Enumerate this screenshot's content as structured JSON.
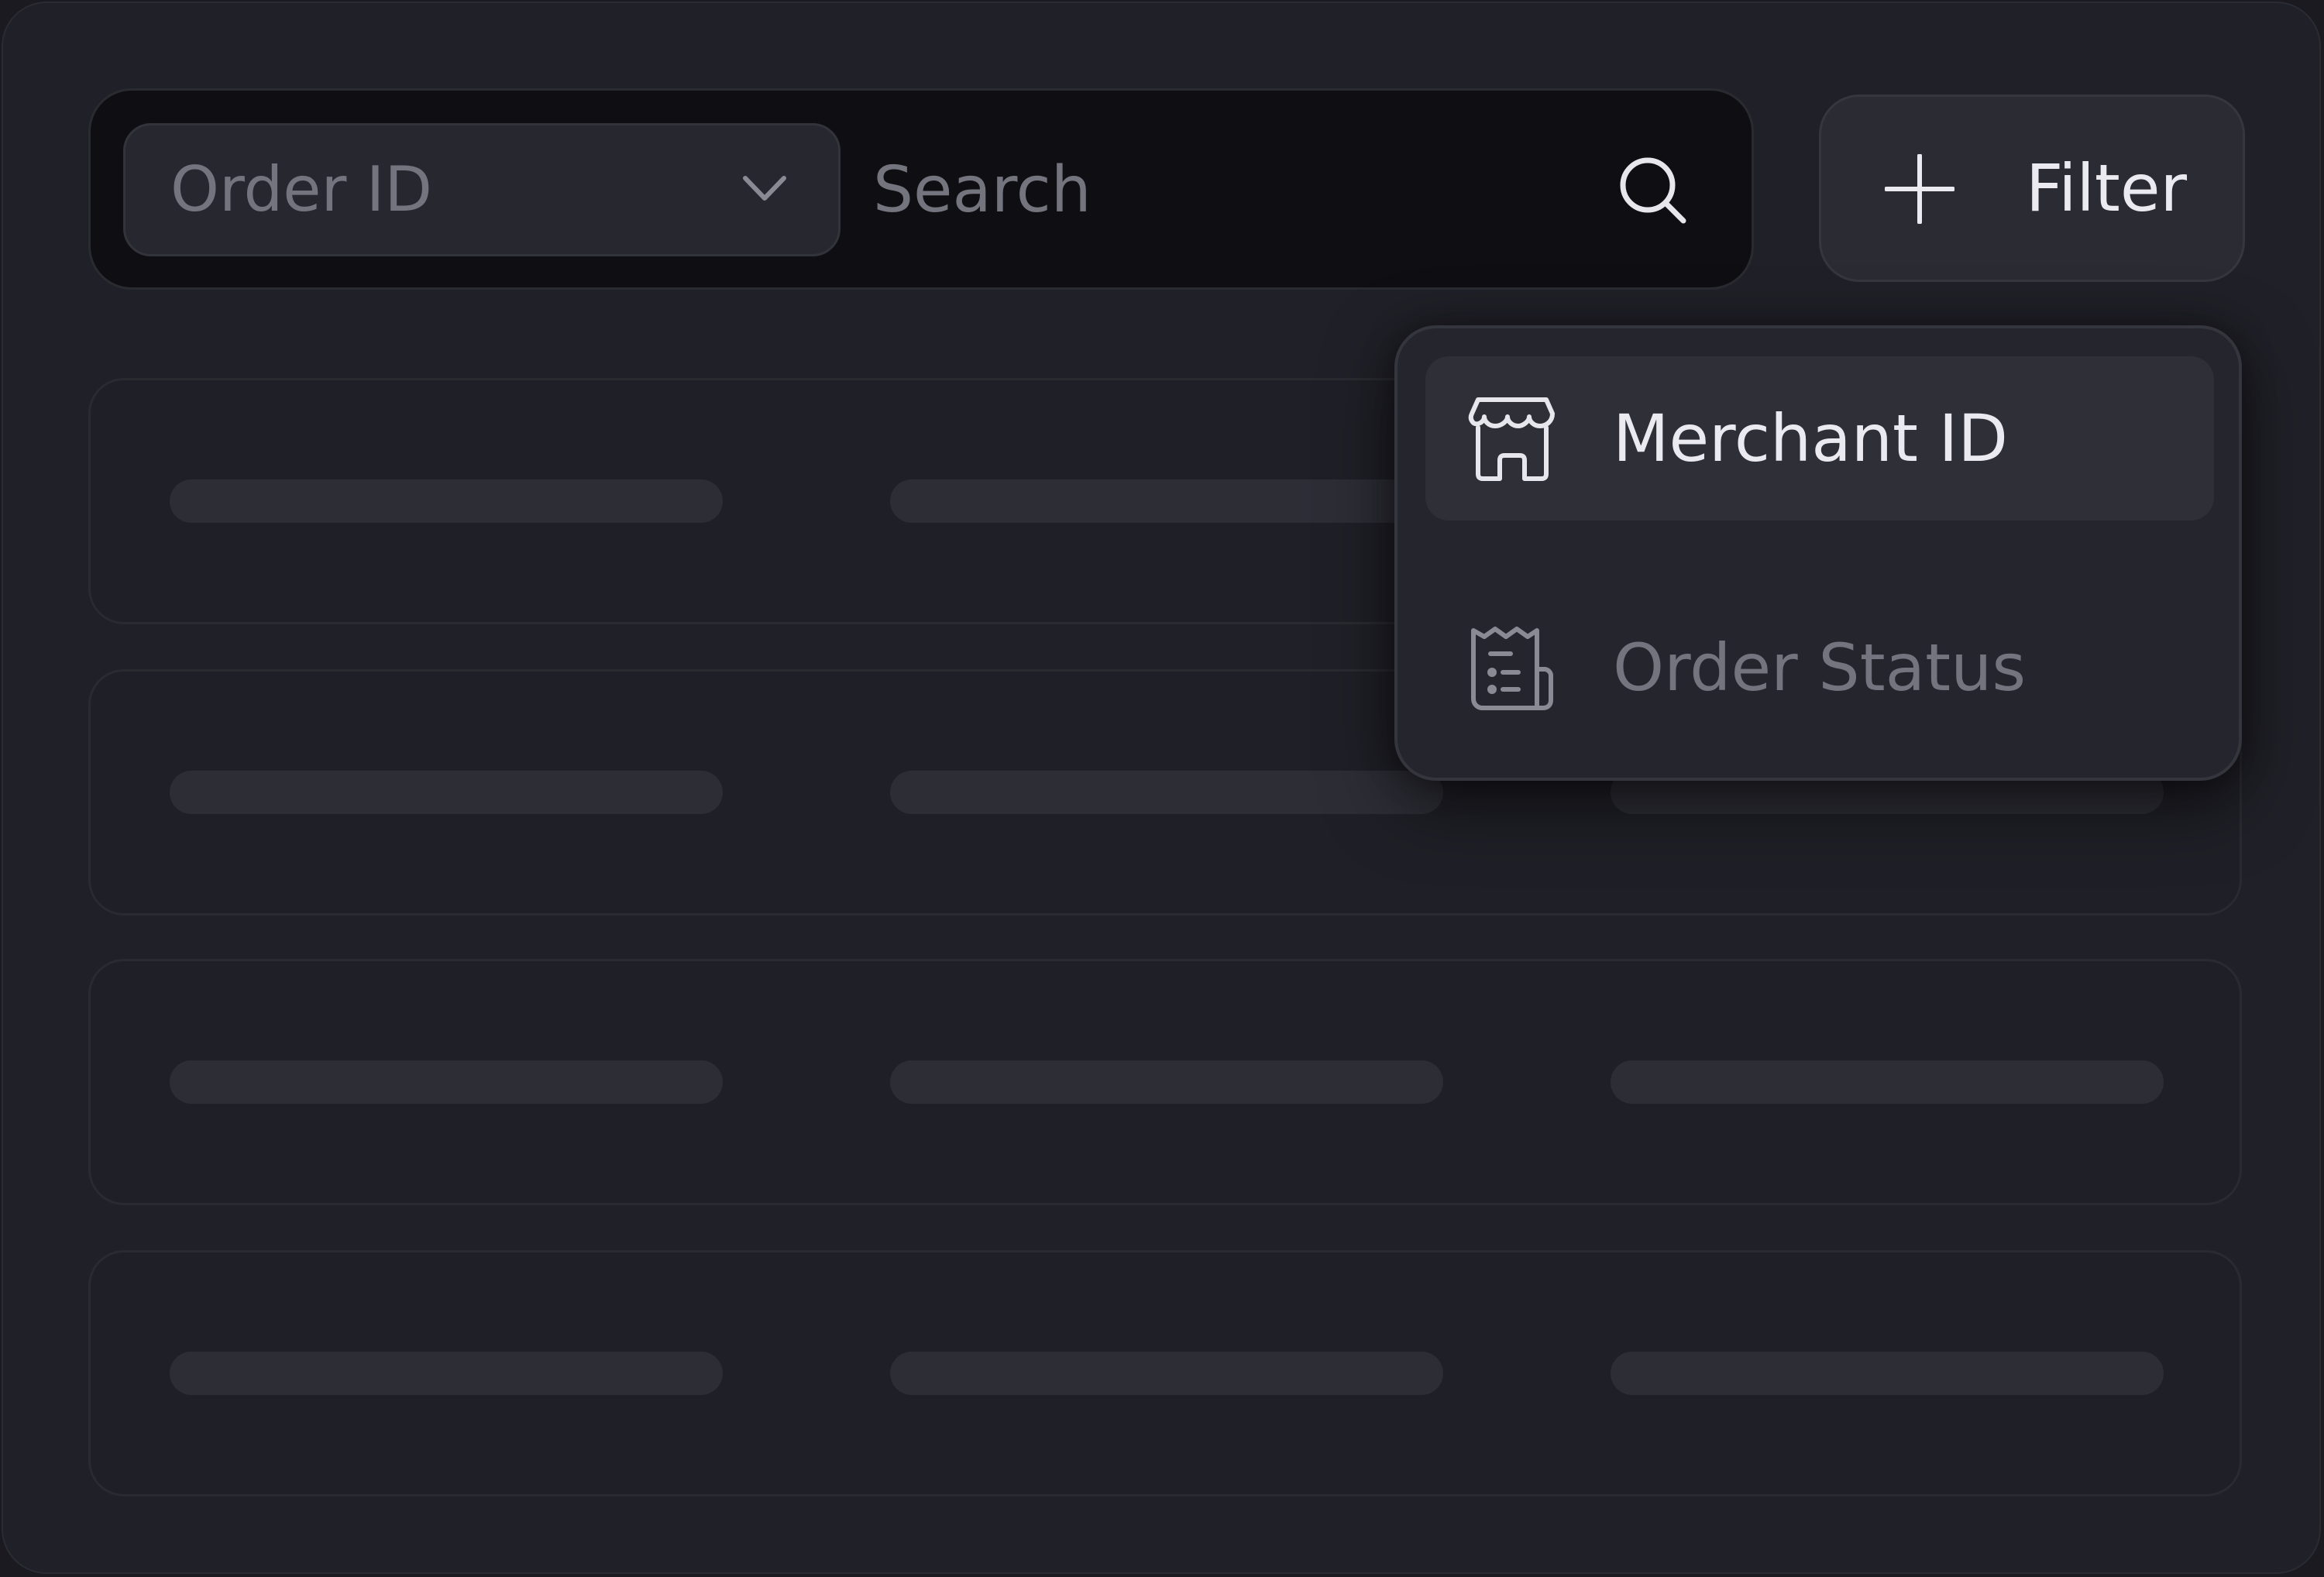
{
  "search": {
    "field_selected": "Order ID",
    "placeholder": "Search"
  },
  "filter_button": {
    "label": "Filter"
  },
  "dropdown": {
    "items": [
      {
        "label": "Merchant ID",
        "icon": "store-icon",
        "active": true
      },
      {
        "label": "Order Status",
        "icon": "receipt-icon",
        "active": false
      }
    ]
  },
  "colors": {
    "background": "#202028",
    "panel": "#0f0f13",
    "text_primary": "#eaeaf0",
    "text_muted": "#74747e",
    "skeleton": "#2d2d36"
  }
}
